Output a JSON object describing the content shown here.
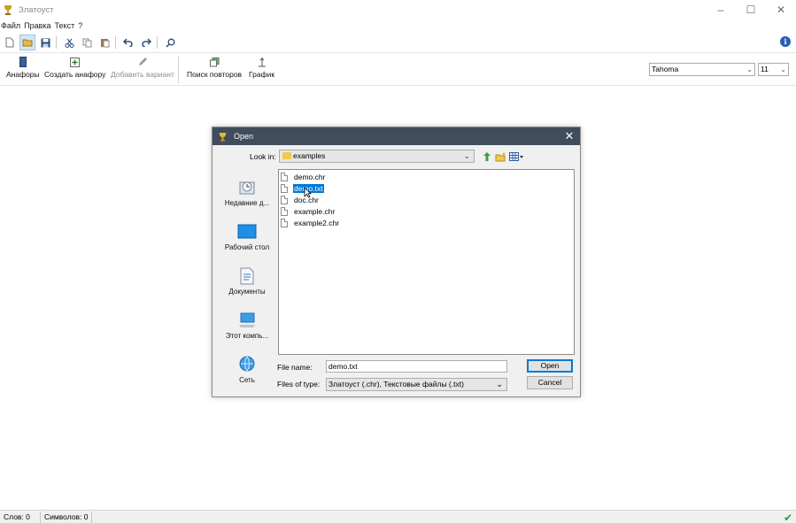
{
  "window": {
    "title": "Златоуст"
  },
  "menu": [
    "Файл",
    "Правка",
    "Текст",
    "?"
  ],
  "toolbar": {
    "buttons": [
      {
        "label": "Анафоры",
        "enabled": true
      },
      {
        "label": "Создать анафору",
        "enabled": true
      },
      {
        "label": "Добавить вариант",
        "enabled": false
      },
      {
        "label": "Поиск повторов",
        "enabled": true
      },
      {
        "label": "График",
        "enabled": true
      }
    ],
    "font_family": "Tahoma",
    "font_size": "11"
  },
  "status": {
    "words": "Слов: 0",
    "chars": "Символов: 0"
  },
  "dialog": {
    "title": "Open",
    "look_in_label": "Look in:",
    "look_in_value": "examples",
    "places": [
      "Недавние д...",
      "Рабочий стол",
      "Документы",
      "Этот компь...",
      "Сеть"
    ],
    "files": [
      {
        "name": "demo.chr",
        "selected": false
      },
      {
        "name": "demo.txt",
        "selected": true
      },
      {
        "name": "doc.chr",
        "selected": false
      },
      {
        "name": "example.chr",
        "selected": false
      },
      {
        "name": "example2.chr",
        "selected": false
      }
    ],
    "file_name_label": "File name:",
    "file_name_value": "demo.txt",
    "file_type_label": "Files of type:",
    "file_type_value": "Златоуст (.chr), Текстовые файлы (.txt)",
    "open_label": "Open",
    "cancel_label": "Cancel"
  },
  "colors": {
    "dialog_title_bg": "#3f4d5c",
    "selection": "#0078d7",
    "check": "#2e9b2e"
  }
}
